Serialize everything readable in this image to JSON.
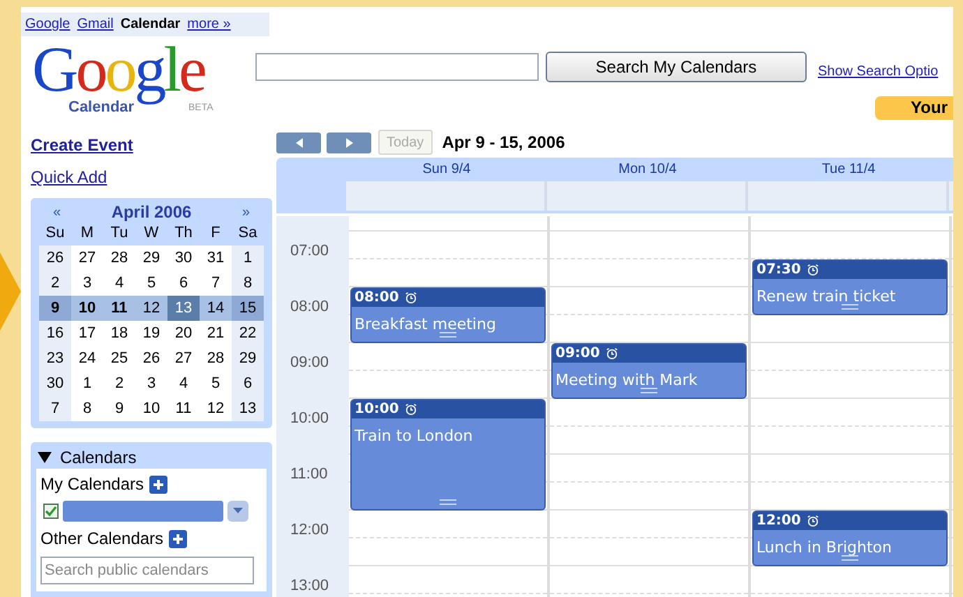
{
  "top_links": [
    {
      "label": "Google",
      "selected": false
    },
    {
      "label": "Gmail",
      "selected": false
    },
    {
      "label": "Calendar",
      "selected": true
    },
    {
      "label": "more »",
      "selected": false
    }
  ],
  "logo": {
    "word": "Google",
    "product": "Calendar",
    "badge": "BETA"
  },
  "search": {
    "button": "Search My Calendars",
    "options_link": "Show Search Optio"
  },
  "account_badge": "Your",
  "sidebar": {
    "create_event": "Create Event",
    "quick_add": "Quick Add"
  },
  "mini_calendar": {
    "prev": "«",
    "month": "April 2006",
    "next": "»",
    "weekdays": [
      "Su",
      "M",
      "Tu",
      "W",
      "Th",
      "F",
      "Sa"
    ],
    "weeks": [
      {
        "selected": false,
        "days": [
          {
            "d": "26",
            "bold": false,
            "today": false
          },
          {
            "d": "27",
            "bold": false,
            "today": false
          },
          {
            "d": "28",
            "bold": false,
            "today": false
          },
          {
            "d": "29",
            "bold": false,
            "today": false
          },
          {
            "d": "30",
            "bold": false,
            "today": false
          },
          {
            "d": "31",
            "bold": false,
            "today": false
          },
          {
            "d": "1",
            "bold": false,
            "today": false
          }
        ]
      },
      {
        "selected": false,
        "days": [
          {
            "d": "2",
            "bold": false,
            "today": false
          },
          {
            "d": "3",
            "bold": false,
            "today": false
          },
          {
            "d": "4",
            "bold": false,
            "today": false
          },
          {
            "d": "5",
            "bold": false,
            "today": false
          },
          {
            "d": "6",
            "bold": false,
            "today": false
          },
          {
            "d": "7",
            "bold": false,
            "today": false
          },
          {
            "d": "8",
            "bold": false,
            "today": false
          }
        ]
      },
      {
        "selected": true,
        "days": [
          {
            "d": "9",
            "bold": true,
            "today": false
          },
          {
            "d": "10",
            "bold": true,
            "today": false
          },
          {
            "d": "11",
            "bold": true,
            "today": false
          },
          {
            "d": "12",
            "bold": false,
            "today": false
          },
          {
            "d": "13",
            "bold": false,
            "today": true
          },
          {
            "d": "14",
            "bold": false,
            "today": false
          },
          {
            "d": "15",
            "bold": false,
            "today": false
          }
        ]
      },
      {
        "selected": false,
        "days": [
          {
            "d": "16",
            "bold": false,
            "today": false
          },
          {
            "d": "17",
            "bold": false,
            "today": false
          },
          {
            "d": "18",
            "bold": false,
            "today": false
          },
          {
            "d": "19",
            "bold": false,
            "today": false
          },
          {
            "d": "20",
            "bold": false,
            "today": false
          },
          {
            "d": "21",
            "bold": false,
            "today": false
          },
          {
            "d": "22",
            "bold": false,
            "today": false
          }
        ]
      },
      {
        "selected": false,
        "days": [
          {
            "d": "23",
            "bold": false,
            "today": false
          },
          {
            "d": "24",
            "bold": false,
            "today": false
          },
          {
            "d": "25",
            "bold": false,
            "today": false
          },
          {
            "d": "26",
            "bold": false,
            "today": false
          },
          {
            "d": "27",
            "bold": false,
            "today": false
          },
          {
            "d": "28",
            "bold": false,
            "today": false
          },
          {
            "d": "29",
            "bold": false,
            "today": false
          }
        ]
      },
      {
        "selected": false,
        "days": [
          {
            "d": "30",
            "bold": false,
            "today": false
          },
          {
            "d": "1",
            "bold": false,
            "today": false
          },
          {
            "d": "2",
            "bold": false,
            "today": false
          },
          {
            "d": "3",
            "bold": false,
            "today": false
          },
          {
            "d": "4",
            "bold": false,
            "today": false
          },
          {
            "d": "5",
            "bold": false,
            "today": false
          },
          {
            "d": "6",
            "bold": false,
            "today": false
          }
        ]
      },
      {
        "selected": false,
        "days": [
          {
            "d": "7",
            "bold": false,
            "today": false
          },
          {
            "d": "8",
            "bold": false,
            "today": false
          },
          {
            "d": "9",
            "bold": false,
            "today": false
          },
          {
            "d": "10",
            "bold": false,
            "today": false
          },
          {
            "d": "11",
            "bold": false,
            "today": false
          },
          {
            "d": "12",
            "bold": false,
            "today": false
          },
          {
            "d": "13",
            "bold": false,
            "today": false
          }
        ]
      }
    ]
  },
  "calendars": {
    "title": "Calendars",
    "expanded": true,
    "my_label": "My Calendars",
    "my_items": [
      {
        "checked": true
      }
    ],
    "other_label": "Other Calendars",
    "search_placeholder": "Search public calendars"
  },
  "toolbar": {
    "today": "Today",
    "today_disabled": true,
    "range": "Apr 9 - 15, 2006"
  },
  "days": [
    {
      "label": "Sun 9/4",
      "events": [
        {
          "start": "08:00",
          "title": "Breakfast meeting",
          "kind": "short"
        },
        {
          "start": "10:00",
          "title": "Train to London",
          "kind": "long"
        }
      ]
    },
    {
      "label": "Mon 10/4",
      "events": [
        {
          "start": "09:00",
          "title": "Meeting with Mark",
          "kind": "short"
        }
      ]
    },
    {
      "label": "Tue 11/4",
      "events": [
        {
          "start": "07:30",
          "title": "Renew train ticket",
          "kind": "short"
        },
        {
          "start": "12:00",
          "title": "Lunch in Brighton",
          "kind": "short"
        }
      ]
    }
  ],
  "hours": [
    "07:00",
    "08:00",
    "09:00",
    "10:00",
    "11:00",
    "12:00",
    "13:00"
  ]
}
